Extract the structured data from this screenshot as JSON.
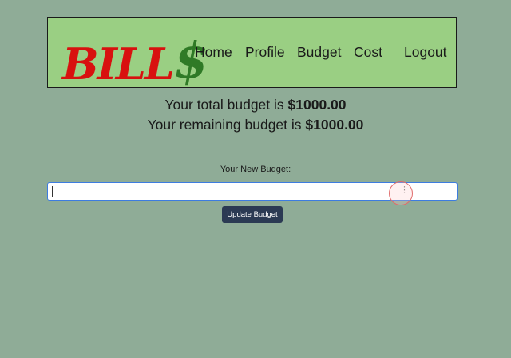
{
  "logo": {
    "main": "BILL",
    "dollar": "$"
  },
  "nav": {
    "items": [
      {
        "label": "Home"
      },
      {
        "label": "Profile"
      },
      {
        "label": "Budget"
      },
      {
        "label": "Cost"
      },
      {
        "label": "Logout"
      }
    ]
  },
  "summary": {
    "total_prefix": "Your total budget is ",
    "total_value": "$1000.00",
    "remaining_prefix": "Your remaining budget is ",
    "remaining_value": "$1000.00"
  },
  "form": {
    "label": "Your New Budget:",
    "input_value": "",
    "input_menu_glyph": "⋮",
    "submit_label": "Update Budget"
  },
  "colors": {
    "background": "#8fac97",
    "header": "#9acf83",
    "logo_red": "#d8110f",
    "logo_green": "#2f7a26",
    "button": "#2b3a53",
    "input_focus": "#3d7ce0"
  }
}
